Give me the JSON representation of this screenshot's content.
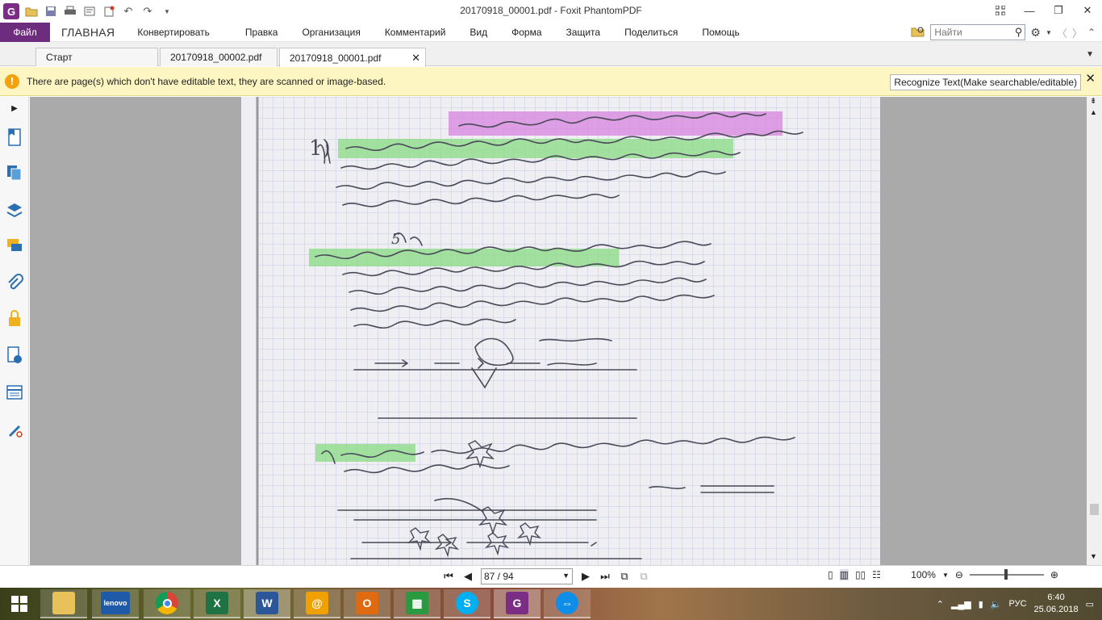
{
  "window": {
    "title": "20170918_00001.pdf - Foxit PhantomPDF"
  },
  "ribbon": {
    "file": "Файл",
    "tabs": [
      "ГЛАВНАЯ",
      "Конвертировать",
      "Правка",
      "Организация",
      "Комментарий",
      "Вид",
      "Форма",
      "Защита",
      "Поделиться",
      "Помощь"
    ],
    "search_placeholder": "Найти"
  },
  "doc_tabs": [
    {
      "label": "Старт"
    },
    {
      "label": "20170918_00002.pdf"
    },
    {
      "label": "20170918_00001.pdf"
    }
  ],
  "infobar": {
    "message": "There are page(s) which don't have editable text, they are scanned or image-based.",
    "button": "Recognize Text(Make searchable/editable)"
  },
  "status": {
    "page": "87 / 94",
    "zoom": "100%"
  },
  "scroll_position": 0.9,
  "zoom_slider_level": 0.5,
  "tray": {
    "lang": "РУС",
    "time": "6:40",
    "date": "25.06.2018"
  },
  "taskbar_apps": [
    "explorer-icon",
    "lenovo-icon",
    "chrome-icon",
    "excel-icon",
    "word-icon",
    "mail-icon",
    "outlook-icon",
    "store-icon",
    "skype-icon",
    "foxit-pdf-icon",
    "teamviewer-icon"
  ],
  "colors": {
    "file_tab": "#6e2c7e",
    "infobar_bg": "#fdf6c3",
    "warning": "#f2a20c"
  }
}
